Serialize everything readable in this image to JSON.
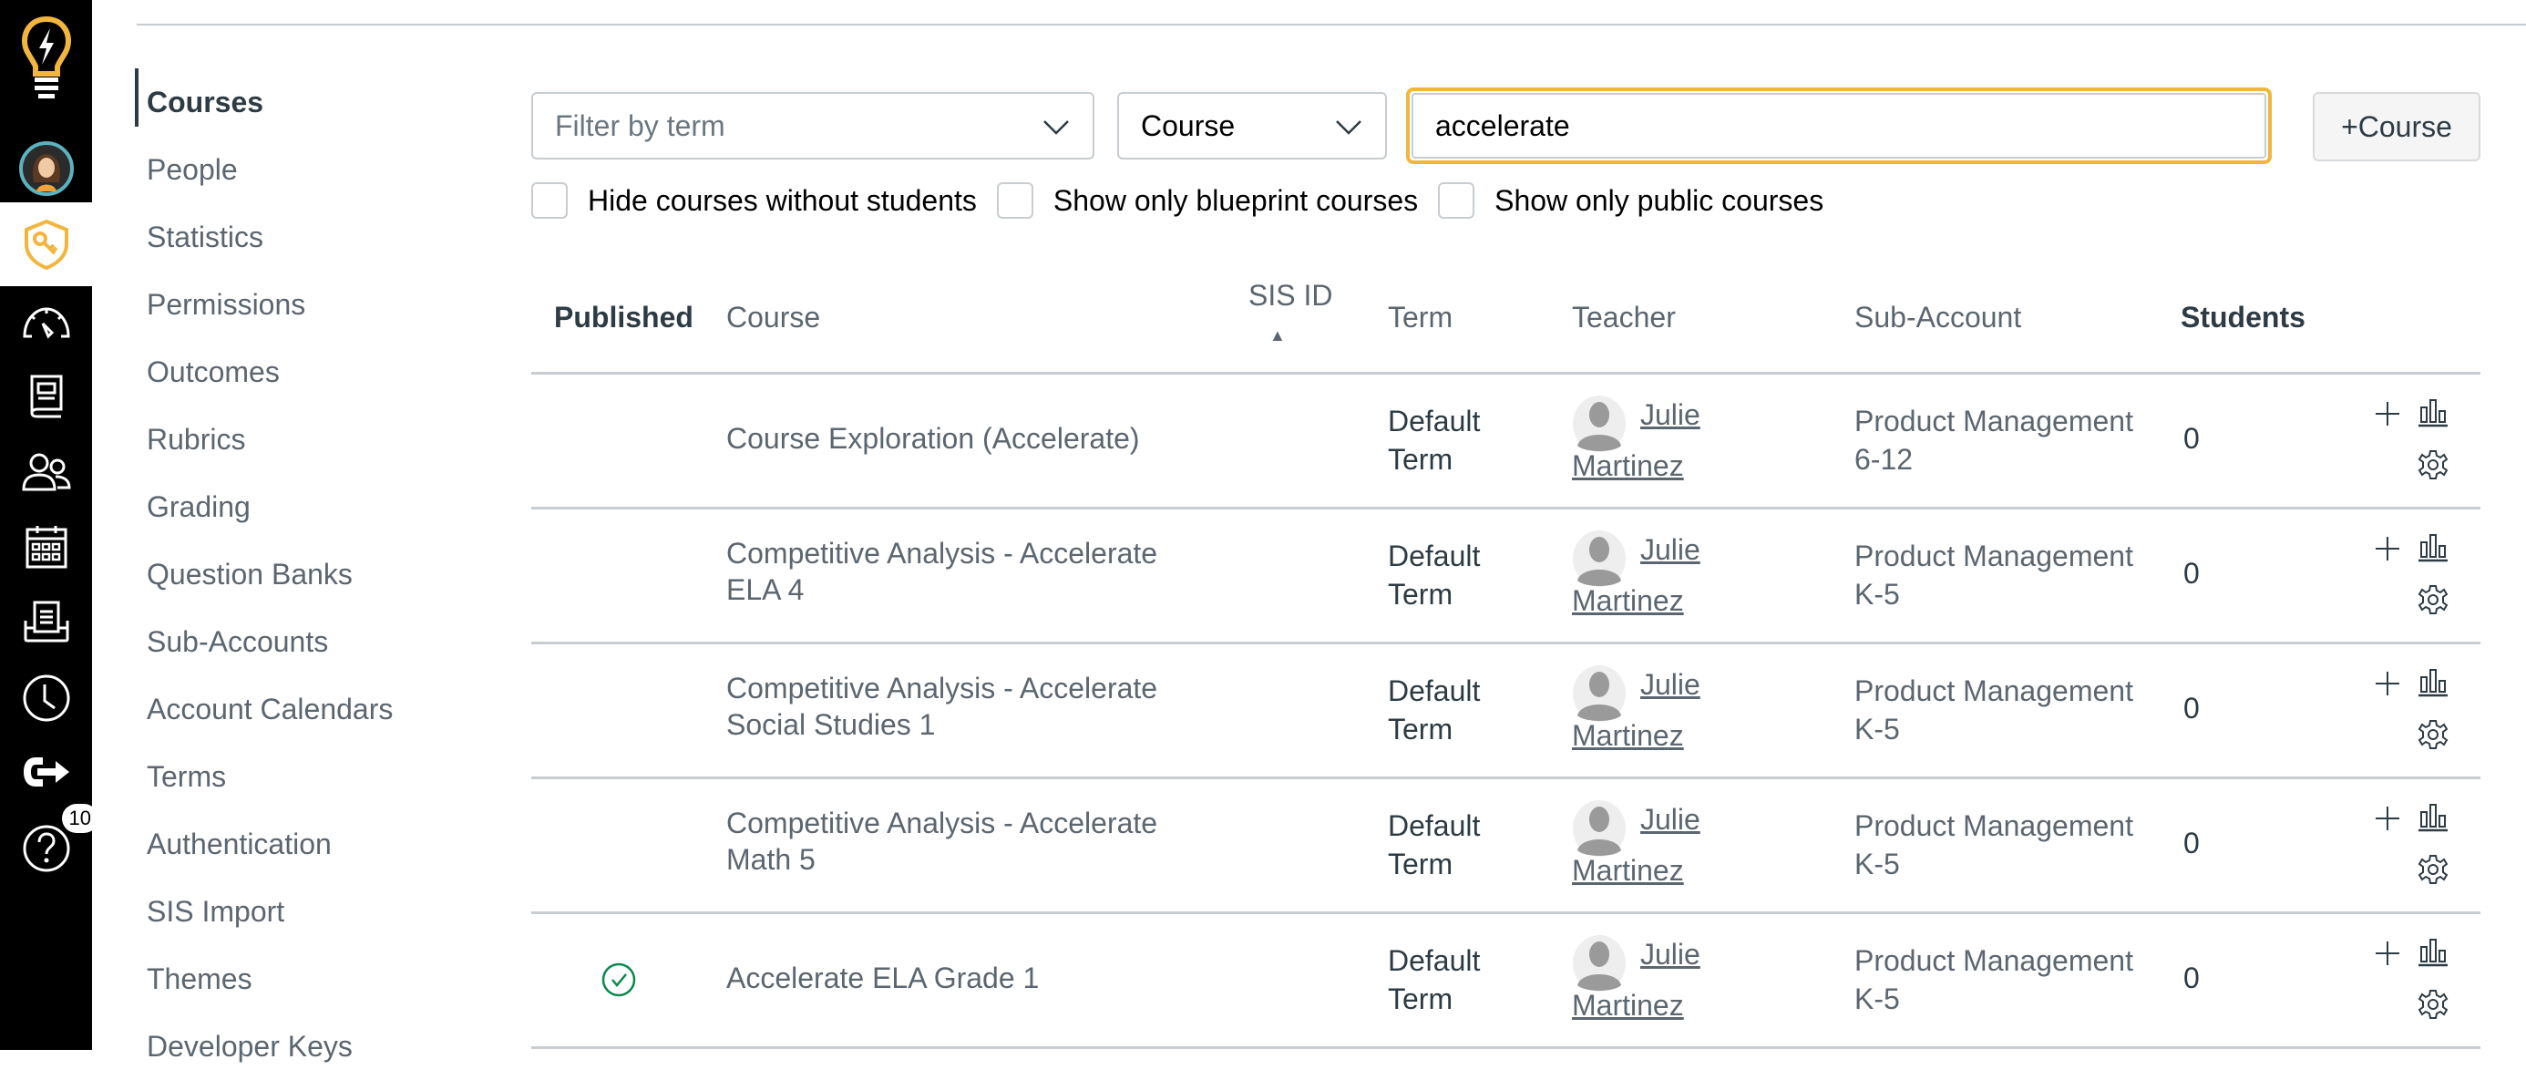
{
  "global_nav": {
    "items": [
      {
        "name": "logo",
        "icon": "lightbulb-icon"
      },
      {
        "name": "account",
        "icon": "avatar"
      },
      {
        "name": "admin",
        "icon": "shield-key-icon",
        "active": true
      },
      {
        "name": "dashboard",
        "icon": "speedometer-icon"
      },
      {
        "name": "courses",
        "icon": "book-icon"
      },
      {
        "name": "groups",
        "icon": "people-icon"
      },
      {
        "name": "calendar",
        "icon": "calendar-icon"
      },
      {
        "name": "inbox",
        "icon": "inbox-icon"
      },
      {
        "name": "history",
        "icon": "clock-icon"
      },
      {
        "name": "commons",
        "icon": "arrow-out-icon"
      },
      {
        "name": "help",
        "icon": "help-icon",
        "badge": "10"
      }
    ],
    "accent": "#f2b53e"
  },
  "sub_nav": {
    "items": [
      {
        "label": "Courses",
        "active": true
      },
      {
        "label": "People"
      },
      {
        "label": "Statistics"
      },
      {
        "label": "Permissions"
      },
      {
        "label": "Outcomes"
      },
      {
        "label": "Rubrics"
      },
      {
        "label": "Grading"
      },
      {
        "label": "Question Banks"
      },
      {
        "label": "Sub-Accounts"
      },
      {
        "label": "Account Calendars"
      },
      {
        "label": "Terms"
      },
      {
        "label": "Authentication"
      },
      {
        "label": "SIS Import"
      },
      {
        "label": "Themes"
      },
      {
        "label": "Developer Keys"
      }
    ]
  },
  "filters": {
    "term_placeholder": "Filter by term",
    "search_by_value": "Course",
    "search_value": "accelerate",
    "add_course_label": "+Course",
    "checkboxes": [
      {
        "label": "Hide courses without students",
        "checked": false
      },
      {
        "label": "Show only blueprint courses",
        "checked": false
      },
      {
        "label": "Show only public courses",
        "checked": false
      }
    ]
  },
  "table": {
    "headers": {
      "published": "Published",
      "course": "Course",
      "sis_id": "SIS ID",
      "sort_indicator": "▲",
      "term": "Term",
      "teacher": "Teacher",
      "sub_account": "Sub-Account",
      "students": "Students"
    },
    "rows": [
      {
        "published": false,
        "course_l1": "Course Exploration (Accelerate)",
        "course_l2": "",
        "term_l1": "Default",
        "term_l2": "Term",
        "teacher_first": "Julie",
        "teacher_last": "Martinez",
        "sub_l1": "Product Management",
        "sub_l2": "6-12",
        "students": "0"
      },
      {
        "published": false,
        "course_l1": "Competitive Analysis - Accelerate",
        "course_l2": "ELA 4",
        "term_l1": "Default",
        "term_l2": "Term",
        "teacher_first": "Julie",
        "teacher_last": "Martinez",
        "sub_l1": "Product Management",
        "sub_l2": "K-5",
        "students": "0"
      },
      {
        "published": false,
        "course_l1": "Competitive Analysis - Accelerate",
        "course_l2": "Social Studies 1",
        "term_l1": "Default",
        "term_l2": "Term",
        "teacher_first": "Julie",
        "teacher_last": "Martinez",
        "sub_l1": "Product Management",
        "sub_l2": "K-5",
        "students": "0"
      },
      {
        "published": false,
        "course_l1": "Competitive Analysis - Accelerate",
        "course_l2": "Math 5",
        "term_l1": "Default",
        "term_l2": "Term",
        "teacher_first": "Julie",
        "teacher_last": "Martinez",
        "sub_l1": "Product Management",
        "sub_l2": "K-5",
        "students": "0"
      },
      {
        "published": true,
        "course_l1": "Accelerate ELA Grade 1",
        "course_l2": "",
        "term_l1": "Default",
        "term_l2": "Term",
        "teacher_first": "Julie",
        "teacher_last": "Martinez",
        "sub_l1": "Product Management",
        "sub_l2": "K-5",
        "students": "0"
      }
    ]
  }
}
